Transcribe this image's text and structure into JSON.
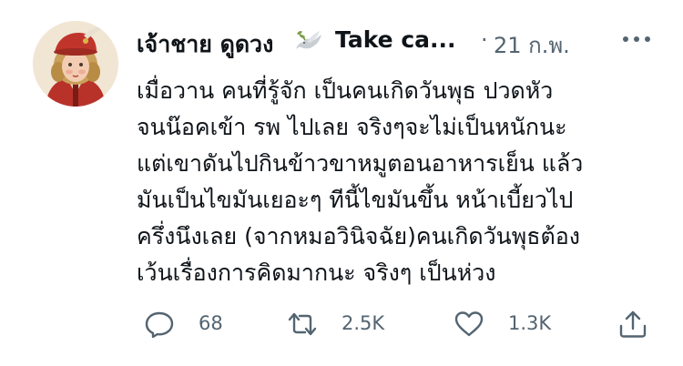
{
  "tweet": {
    "author": {
      "display_name": "เจ้าชาย ดูดวง",
      "name_emoji_icon": "dove-icon",
      "name_suffix": "Take ca...",
      "avatar": "avatar-doll-in-red-hat"
    },
    "separator": "·",
    "date": "21 ก.พ.",
    "more_icon": "more-horizontal-icon",
    "body_lines": [
      "เมื่อวาน คนที่รู้จัก เป็นคนเกิดวันพุธ ปวดหัว",
      "จนน๊อคเข้า รพ ไปเลย จริงๆจะไม่เป็นหนักนะ",
      "แต่เขาดันไปกินข้าวขาหมูตอนอาหารเย็น แล้ว",
      "มันเป็นไขมันเยอะๆ ทีนี้ไขมันขึ้น หน้าเบี้ยวไป",
      "ครึ่งนึงเลย (จากหมอวินิจฉัย)คนเกิดวันพุธต้อง",
      "เว้นเรื่องการคิดมากนะ จริงๆ เป็นห่วง"
    ],
    "actions": {
      "reply": {
        "icon": "reply-icon",
        "count": "68"
      },
      "retweet": {
        "icon": "retweet-icon",
        "count": "2.5K"
      },
      "like": {
        "icon": "heart-icon",
        "count": "1.3K"
      },
      "share": {
        "icon": "share-icon"
      }
    },
    "colors": {
      "text": "#0f1419",
      "secondary": "#536471",
      "background": "#ffffff"
    }
  }
}
